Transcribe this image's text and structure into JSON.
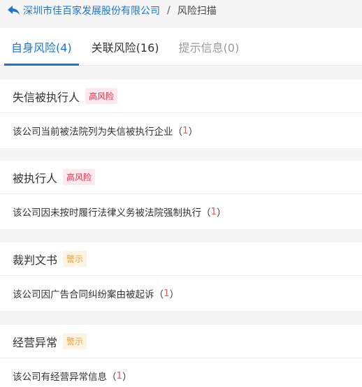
{
  "breadcrumb": {
    "company": "深圳市佳百家发展股份有限公司",
    "separator": "/",
    "current": "风险扫描"
  },
  "tabs": [
    {
      "label": "自身风险(4)",
      "state": "active"
    },
    {
      "label": "关联风险(16)",
      "state": "normal"
    },
    {
      "label": "提示信息(0)",
      "state": "disabled"
    }
  ],
  "risks": [
    {
      "title": "失信被执行人",
      "level": "高风险",
      "level_type": "high",
      "desc": "该公司当前被法院列为失信被执行企业",
      "count": "1"
    },
    {
      "title": "被执行人",
      "level": "高风险",
      "level_type": "high",
      "desc": "该公司因未按时履行法律义务被法院强制执行",
      "count": "1"
    },
    {
      "title": "裁判文书",
      "level": "警示",
      "level_type": "warn",
      "desc": "该公司因广告合同纠纷案由被起诉",
      "count": "1"
    },
    {
      "title": "经营异常",
      "level": "警示",
      "level_type": "warn",
      "desc": "该公司有经营异常信息",
      "count": "1"
    }
  ],
  "colors": {
    "accent": "#1976d2",
    "high_risk": "#e0304b",
    "warning": "#e5a33a"
  }
}
